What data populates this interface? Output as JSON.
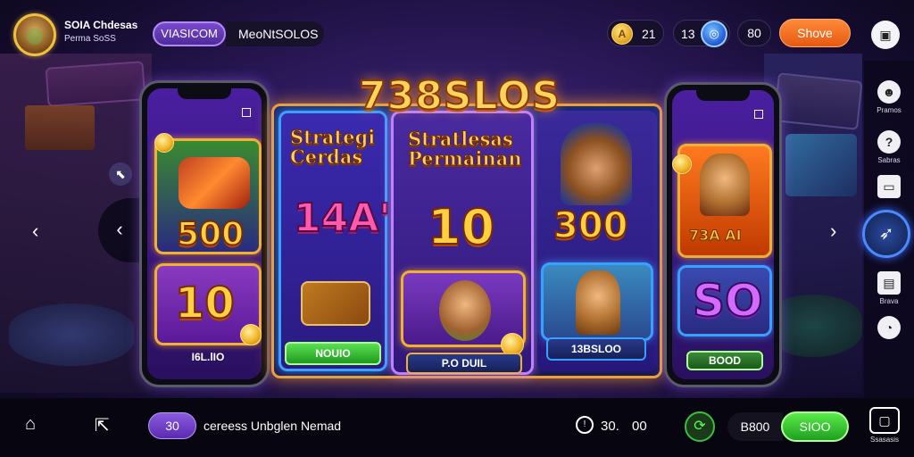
{
  "header": {
    "brand_title": "SOIA Chdesas",
    "brand_subtitle": "Perma SoSS",
    "tab_active": "VIASICOM",
    "tab_label": "MeoNtSOLOS",
    "coins_value": "21",
    "coins_icon": "coin-icon",
    "gems_value": "13",
    "gems_icon": "gem-icon",
    "level_value": "80",
    "action_button": "Shove",
    "menu_icon": "chat-icon"
  },
  "sidebar": {
    "items": [
      {
        "label": "Pramos",
        "icon": "mask-icon"
      },
      {
        "label": "Sabras",
        "icon": "question-icon"
      },
      {
        "label": "",
        "icon": "card-icon"
      },
      {
        "label": "",
        "icon": "rocket-icon"
      },
      {
        "label": "Brava",
        "icon": "briefcase-icon"
      },
      {
        "label": "",
        "icon": "clock-icon"
      }
    ]
  },
  "banner": {
    "title": "738SLOS"
  },
  "cards": [
    {
      "value": "500",
      "value2": "10",
      "footer": "I6L.lIO"
    },
    {
      "title": "Strategi Cerdas",
      "value": "14A'",
      "button": "NOUIO"
    },
    {
      "title": "Stratlesas Permainan",
      "value": "10",
      "button": "P.O DUIL"
    },
    {
      "value": "300",
      "button": "13BSLOO"
    },
    {
      "value": "73A AI",
      "value2": "SO",
      "button": "BOOD"
    }
  ],
  "bottombar": {
    "back_icon": "home-icon",
    "share_icon": "share-icon",
    "pill_value": "30",
    "status_text": "cereess Unbglen Nemad",
    "timer_icon": "timer-icon",
    "val1": "30.",
    "val2": "00",
    "refresh_icon": "refresh-icon",
    "amount": "B800",
    "confirm_button": "SIOO",
    "square_label": "Ssasasis"
  }
}
